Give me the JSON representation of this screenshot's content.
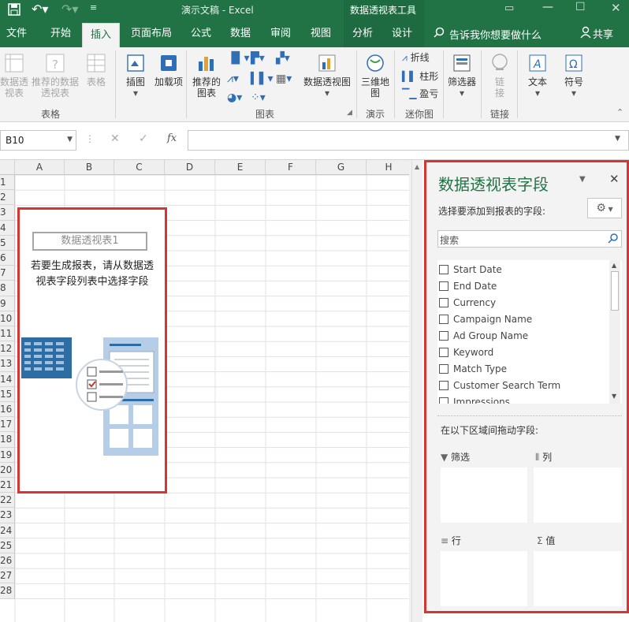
{
  "window": {
    "title": "演示文稿  -  Excel",
    "context_tab": "数据透视表工具"
  },
  "tabs": [
    "文件",
    "开始",
    "插入",
    "页面布局",
    "公式",
    "数据",
    "审阅",
    "视图",
    "分析",
    "设计"
  ],
  "tell_me": "告诉我你想要做什么",
  "share": "共享",
  "ribbon": {
    "pivot_table": "数据透视表",
    "recommended_pivot": "推荐的数据透视表",
    "table": "表格",
    "group_tables": "表格",
    "illustrations": "插图",
    "addins": "加载项",
    "recommended_charts": "推荐的图表",
    "pivot_chart": "数据透视图",
    "group_charts": "图表",
    "map3d": "三维地图",
    "group_tours": "演示",
    "spark_line": "折线",
    "spark_column": "柱形",
    "spark_winloss": "盈亏",
    "group_sparklines": "迷你图",
    "slicer": "筛选器",
    "link": "链接",
    "group_links": "链接",
    "text": "文本",
    "symbol": "符号"
  },
  "namebox": "B10",
  "columns": [
    "A",
    "B",
    "C",
    "D",
    "E",
    "F",
    "G",
    "H"
  ],
  "rows": [
    "1",
    "2",
    "3",
    "4",
    "5",
    "6",
    "7",
    "8",
    "9",
    "10",
    "11",
    "12",
    "13",
    "14",
    "15",
    "16",
    "17",
    "18",
    "19",
    "20",
    "21",
    "22",
    "23",
    "24",
    "25",
    "26",
    "27",
    "28"
  ],
  "pivot_placeholder": {
    "title": "数据透视表1",
    "instruction_line1": "若要生成报表，请从数据透",
    "instruction_line2": "视表字段列表中选择字段"
  },
  "pane": {
    "title": "数据透视表字段",
    "choose_label": "选择要添加到报表的字段:",
    "search_placeholder": "搜索",
    "fields": [
      "Start Date",
      "End Date",
      "Currency",
      "Campaign Name",
      "Ad Group Name",
      "Keyword",
      "Match Type",
      "Customer Search Term",
      "Impressions"
    ],
    "drag_label": "在以下区域间拖动字段:",
    "areas": {
      "filter": "筛选",
      "columns": "列",
      "rows": "行",
      "values": "值"
    }
  },
  "colors": {
    "excel_green": "#217346",
    "highlight_red": "#d63534"
  }
}
